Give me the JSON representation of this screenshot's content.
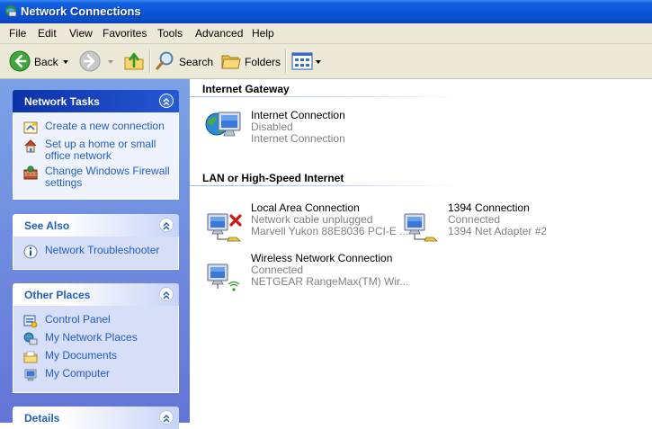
{
  "window": {
    "title": "Network Connections",
    "icon": "network-connections-icon"
  },
  "menu": [
    "File",
    "Edit",
    "View",
    "Favorites",
    "Tools",
    "Advanced",
    "Help"
  ],
  "toolbar": {
    "back_label": "Back",
    "search_label": "Search",
    "folders_label": "Folders"
  },
  "panels": {
    "network_tasks": {
      "title": "Network Tasks",
      "items": [
        "Create a new connection",
        "Set up a home or small office network",
        "Change Windows Firewall settings"
      ]
    },
    "see_also": {
      "title": "See Also",
      "items": [
        "Network Troubleshooter"
      ]
    },
    "other_places": {
      "title": "Other Places",
      "items": [
        "Control Panel",
        "My Network Places",
        "My Documents",
        "My Computer"
      ]
    },
    "details": {
      "title": "Details"
    }
  },
  "groups": [
    {
      "title": "Internet Gateway",
      "connections": [
        {
          "name": "Internet Connection",
          "status": "Disabled",
          "device": "Internet Connection"
        }
      ]
    },
    {
      "title": "LAN or High-Speed Internet",
      "connections": [
        {
          "name": "Local Area Connection",
          "status": "Network cable unplugged",
          "device": "Marvell Yukon 88E8036 PCI-E ..."
        },
        {
          "name": "1394 Connection",
          "status": "Connected",
          "device": "1394 Net Adapter #2"
        },
        {
          "name": "Wireless Network Connection",
          "status": "Connected",
          "device": "NETGEAR RangeMax(TM) Wir..."
        }
      ]
    }
  ],
  "colors": {
    "title_bar": "#0a55d8",
    "task_pane": "#7ba2e7",
    "link": "#215dc6",
    "status_text": "#808080"
  }
}
